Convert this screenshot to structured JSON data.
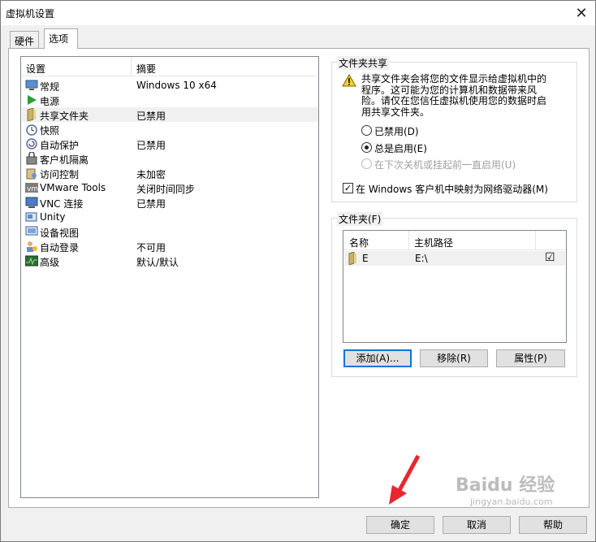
{
  "window": {
    "title": "虚拟机设置",
    "close_glyph": "✕"
  },
  "tabs": [
    {
      "label": "硬件"
    },
    {
      "label": "选项"
    }
  ],
  "settings_list": {
    "header_setting": "设置",
    "header_summary": "摘要",
    "items": [
      {
        "label": "常规",
        "summary": "Windows 10 x64",
        "icon": "general-icon"
      },
      {
        "label": "电源",
        "summary": "",
        "icon": "power-icon"
      },
      {
        "label": "共享文件夹",
        "summary": "已禁用",
        "icon": "shared-folder-icon"
      },
      {
        "label": "快照",
        "summary": "",
        "icon": "snapshot-icon"
      },
      {
        "label": "自动保护",
        "summary": "已禁用",
        "icon": "autoprotect-icon"
      },
      {
        "label": "客户机隔离",
        "summary": "",
        "icon": "isolation-icon"
      },
      {
        "label": "访问控制",
        "summary": "未加密",
        "icon": "access-control-icon"
      },
      {
        "label": "VMware Tools",
        "summary": "关闭时间同步",
        "icon": "vmware-tools-icon"
      },
      {
        "label": "VNC 连接",
        "summary": "已禁用",
        "icon": "vnc-icon"
      },
      {
        "label": "Unity",
        "summary": "",
        "icon": "unity-icon"
      },
      {
        "label": "设备视图",
        "summary": "",
        "icon": "device-view-icon"
      },
      {
        "label": "自动登录",
        "summary": "不可用",
        "icon": "autologin-icon"
      },
      {
        "label": "高级",
        "summary": "默认/默认",
        "icon": "advanced-icon"
      }
    ]
  },
  "folder_sharing": {
    "title": "文件夹共享",
    "warning": "共享文件夹会将您的文件显示给虚拟机中的程序。这可能为您的计算机和数据带来风险。请仅在您信任虚拟机使用您的数据时启用共享文件夹。",
    "options": [
      {
        "label": "已禁用(D)"
      },
      {
        "label": "总是启用(E)"
      },
      {
        "label": "在下次关机或挂起前一直启用(U)"
      }
    ],
    "map_drive_label": "在 Windows 客户机中映射为网络驱动器(M)"
  },
  "folders": {
    "title": "文件夹(F)",
    "col_name": "名称",
    "col_path": "主机路径",
    "rows": [
      {
        "name": "E",
        "path": "E:\\",
        "enabled": "☑"
      }
    ],
    "add_label": "添加(A)...",
    "remove_label": "移除(R)",
    "properties_label": "属性(P)"
  },
  "footer": {
    "ok_label": "确定",
    "cancel_label": "取消",
    "help_label": "帮助"
  },
  "watermark": {
    "text": "Baidu 经验",
    "sub": "jingyan.baidu.com"
  },
  "colors": {
    "accent": "#0078d7",
    "arrow": "#e8262e",
    "power_green": "#22a33a"
  }
}
